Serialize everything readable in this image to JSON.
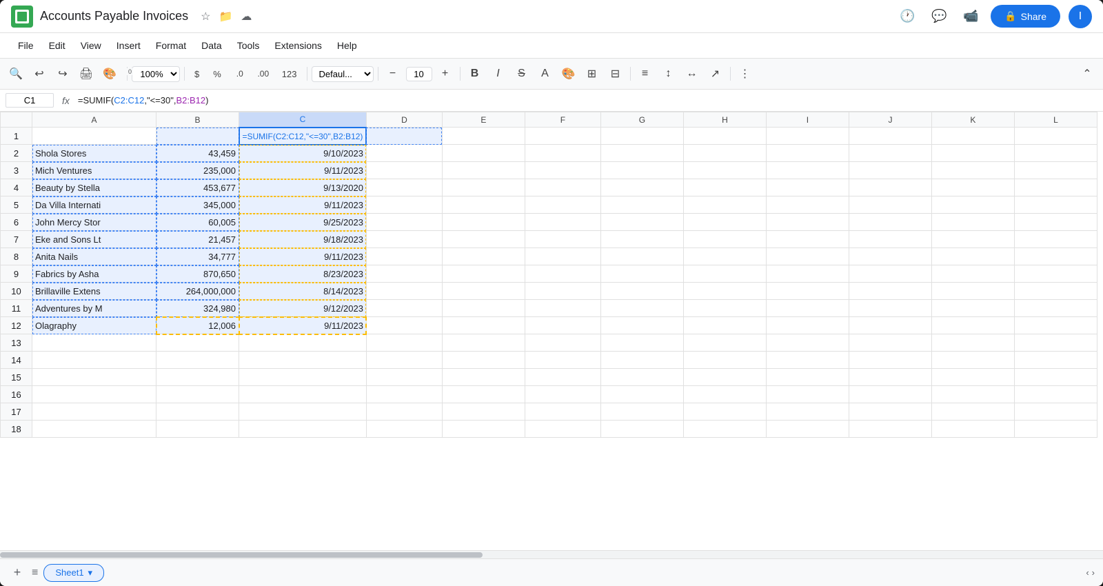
{
  "app": {
    "logo_color": "#34a853",
    "title": "Accounts Payable Invoices",
    "share_label": "Share"
  },
  "menu": {
    "items": [
      "File",
      "Edit",
      "View",
      "Insert",
      "Format",
      "Data",
      "Tools",
      "Extensions",
      "Help"
    ]
  },
  "toolbar": {
    "zoom": "100%",
    "font_format": "Defaul...",
    "font_size": "10",
    "currency_symbol": "$",
    "percent_symbol": "%"
  },
  "formula_bar": {
    "cell_ref": "C1",
    "formula": "=SUMIF(C2:C12,\"<=30\",B2:B12)"
  },
  "columns": [
    "",
    "A",
    "B",
    "C",
    "D",
    "E",
    "F",
    "G",
    "H",
    "I",
    "J",
    "K",
    "L"
  ],
  "rows": [
    {
      "num": 1,
      "a": "",
      "b": "",
      "c": "=SUMIF(C2:C12,\"<=30\",B2:B12)",
      "d": "",
      "e": ""
    },
    {
      "num": 2,
      "a": "Shola Stores",
      "b": "43,459",
      "c": "9/10/2023",
      "d": "",
      "e": ""
    },
    {
      "num": 3,
      "a": "Mich Ventures",
      "b": "235,000",
      "c": "9/11/2023",
      "d": "",
      "e": ""
    },
    {
      "num": 4,
      "a": "Beauty by Stella",
      "b": "453,677",
      "c": "9/13/2020",
      "d": "",
      "e": ""
    },
    {
      "num": 5,
      "a": "Da Villa Internati",
      "b": "345,000",
      "c": "9/11/2023",
      "d": "",
      "e": ""
    },
    {
      "num": 6,
      "a": "John Mercy Stor",
      "b": "60,005",
      "c": "9/25/2023",
      "d": "",
      "e": ""
    },
    {
      "num": 7,
      "a": "Eke and Sons Lt",
      "b": "21,457",
      "c": "9/18/2023",
      "d": "",
      "e": ""
    },
    {
      "num": 8,
      "a": "Anita Nails",
      "b": "34,777",
      "c": "9/11/2023",
      "d": "",
      "e": ""
    },
    {
      "num": 9,
      "a": "Fabrics by Asha",
      "b": "870,650",
      "c": "8/23/2023",
      "d": "",
      "e": ""
    },
    {
      "num": 10,
      "a": "Brillaville Extens",
      "b": "264,000,000",
      "c": "8/14/2023",
      "d": "",
      "e": ""
    },
    {
      "num": 11,
      "a": "Adventures by M",
      "b": "324,980",
      "c": "9/12/2023",
      "d": "",
      "e": ""
    },
    {
      "num": 12,
      "a": "Olagraphy",
      "b": "12,006",
      "c": "9/11/2023",
      "d": "",
      "e": ""
    },
    {
      "num": 13,
      "a": "",
      "b": "",
      "c": "",
      "d": "",
      "e": ""
    },
    {
      "num": 14,
      "a": "",
      "b": "",
      "c": "",
      "d": "",
      "e": ""
    },
    {
      "num": 15,
      "a": "",
      "b": "",
      "c": "",
      "d": "",
      "e": ""
    },
    {
      "num": 16,
      "a": "",
      "b": "",
      "c": "",
      "d": "",
      "e": ""
    },
    {
      "num": 17,
      "a": "",
      "b": "",
      "c": "",
      "d": "",
      "e": ""
    },
    {
      "num": 18,
      "a": "",
      "b": "",
      "c": "",
      "d": "",
      "e": ""
    }
  ],
  "sheet": {
    "tab_label": "Sheet1",
    "dropdown_icon": "▾"
  }
}
